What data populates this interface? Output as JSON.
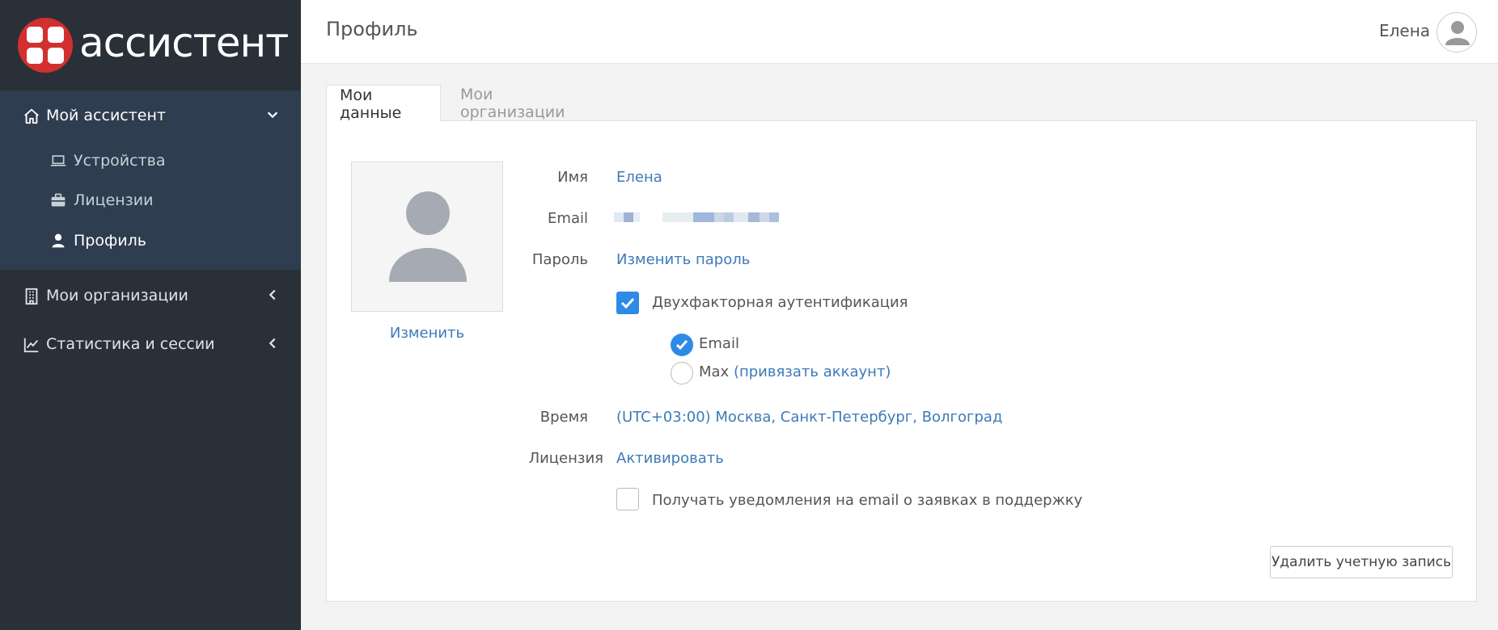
{
  "app": {
    "logo_text": "ассистент"
  },
  "sidebar": {
    "items": [
      {
        "label": "Мой ассистент",
        "icon": "home-icon",
        "expanded": true,
        "children": [
          {
            "label": "Устройства",
            "icon": "laptop-icon"
          },
          {
            "label": "Лицензии",
            "icon": "briefcase-icon"
          },
          {
            "label": "Профиль",
            "icon": "user-icon",
            "active": true
          }
        ]
      },
      {
        "label": "Мои организации",
        "icon": "building-icon"
      },
      {
        "label": "Статистика и сессии",
        "icon": "chart-icon"
      }
    ]
  },
  "header": {
    "title": "Профиль",
    "user_name": "Елена"
  },
  "tabs": [
    {
      "label": "Мои данные",
      "active": true
    },
    {
      "label": "Мои организации",
      "active": false
    }
  ],
  "profile": {
    "photo_change": "Изменить",
    "name_label": "Имя",
    "name_value": "Елена",
    "email_label": "Email",
    "password_label": "Пароль",
    "password_link": "Изменить пароль",
    "two_factor_label": "Двухфакторная аутентификация",
    "two_factor_checked": true,
    "method_email": "Email",
    "method_max": "Max",
    "method_max_link": "(привязать аккаунт)",
    "time_label": "Время",
    "time_value": "(UTC+03:00) Москва, Санкт-Петербург, Волгоград",
    "license_label": "Лицензия",
    "license_link": "Активировать",
    "notify_label": "Получать уведомления на email о заявках в поддержку",
    "notify_checked": false,
    "delete_button": "Удалить учетную запись"
  },
  "colors": {
    "sidebar_bg": "#2a3037",
    "sidebar_open_bg": "#2e3d4f",
    "link": "#3d7ab8",
    "accent": "#2d8ae6",
    "logo_red": "#d32f2f"
  }
}
